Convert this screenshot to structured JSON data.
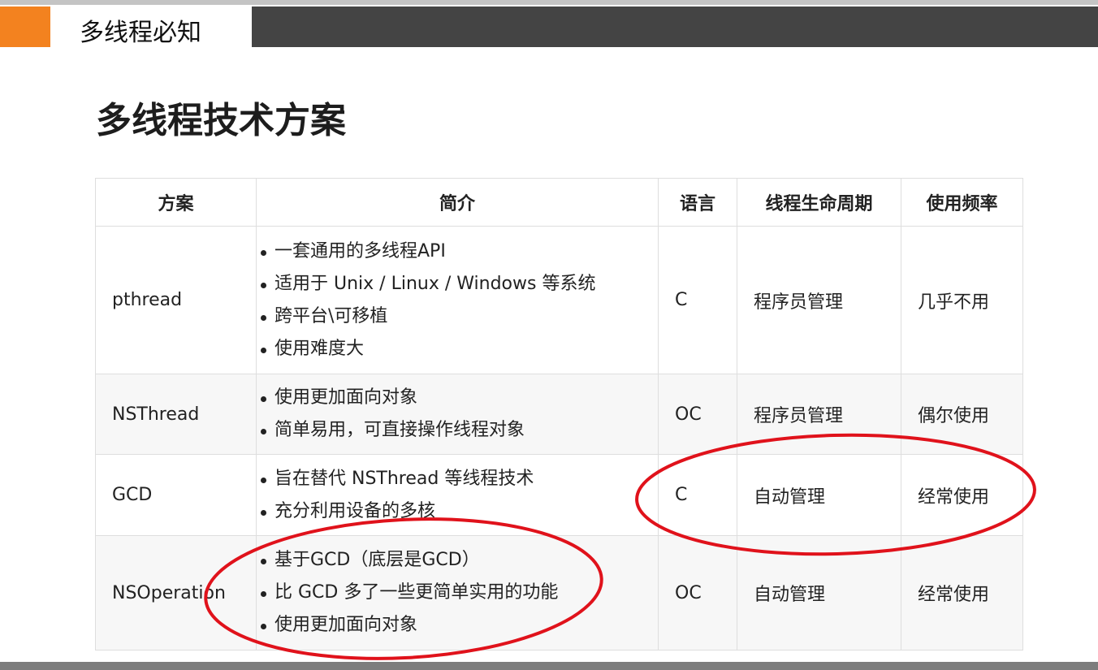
{
  "header": {
    "title": "多线程必知",
    "accent_color": "#f3821f",
    "bar_color": "#444444"
  },
  "heading": "多线程技术方案",
  "table": {
    "columns": [
      "方案",
      "简介",
      "语言",
      "线程生命周期",
      "使用频率"
    ],
    "rows": [
      {
        "name": "pthread",
        "desc": [
          "一套通用的多线程API",
          "适用于 Unix / Linux / Windows 等系统",
          "跨平台\\可移植",
          "使用难度大"
        ],
        "lang": "C",
        "lifecycle": "程序员管理",
        "frequency": "几乎不用"
      },
      {
        "name": "NSThread",
        "desc": [
          "使用更加面向对象",
          "简单易用，可直接操作线程对象"
        ],
        "lang": "OC",
        "lifecycle": "程序员管理",
        "frequency": "偶尔使用"
      },
      {
        "name": "GCD",
        "desc": [
          "旨在替代 NSThread 等线程技术",
          "充分利用设备的多核"
        ],
        "lang": "C",
        "lifecycle": "自动管理",
        "frequency": "经常使用"
      },
      {
        "name": "NSOperation",
        "desc": [
          "基于GCD（底层是GCD）",
          "比 GCD 多了一些更简单实用的功能",
          "使用更加面向对象"
        ],
        "lang": "OC",
        "lifecycle": "自动管理",
        "frequency": "经常使用"
      }
    ]
  },
  "annotation_color": "#e0121b"
}
